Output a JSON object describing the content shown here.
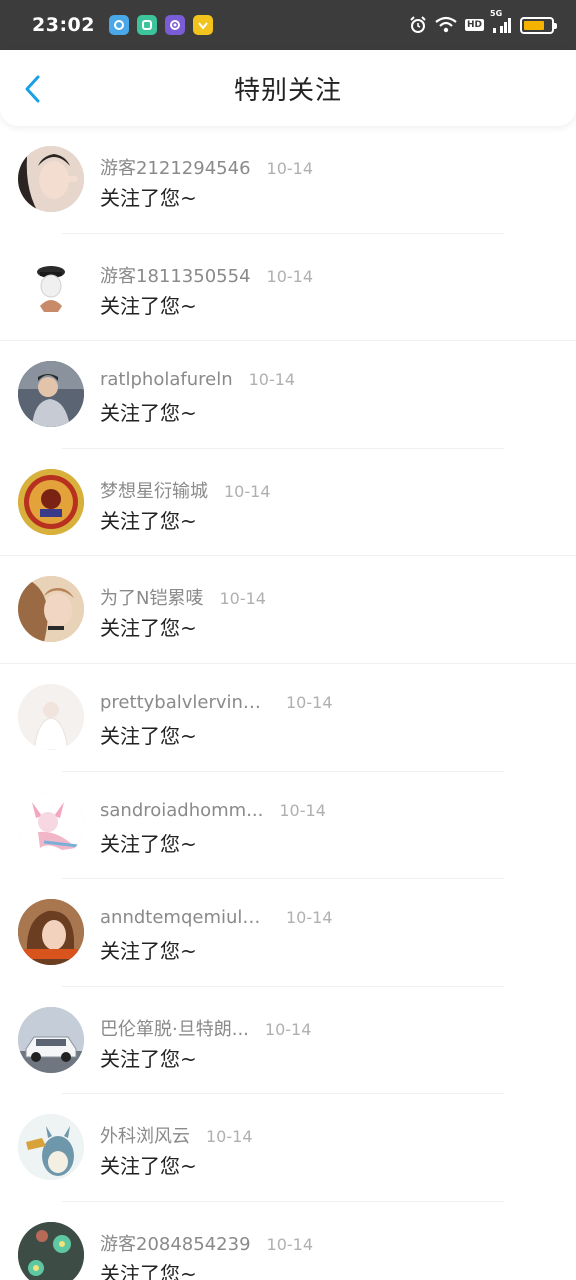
{
  "status_bar": {
    "time": "23:02",
    "app_icons": [
      {
        "name": "browser-app-icon",
        "color": "#4aa8e8"
      },
      {
        "name": "camera-app-icon",
        "color": "#3cc59a"
      },
      {
        "name": "chat-app-icon",
        "color": "#7a5cd6"
      },
      {
        "name": "wallet-app-icon",
        "color": "#f2c21d"
      }
    ],
    "hd_label": "HD",
    "network_label": "5G",
    "battery_level": 0.75
  },
  "header": {
    "title": "特别关注",
    "back_icon": "chevron-left-icon",
    "accent_color": "#1aa0e6"
  },
  "list": [
    {
      "username": "游客2121294546",
      "date": "10-14",
      "message": "关注了您~",
      "avatar_color": "#d9c8bf",
      "avatar_icon": "face-photo"
    },
    {
      "username": "游客1811350554",
      "date": "10-14",
      "message": "关注了您~",
      "avatar_color": "#ffffff",
      "avatar_icon": "bust-figure"
    },
    {
      "username": "ratlpholafureln",
      "date": "10-14",
      "message": "关注了您~",
      "avatar_color": "#4d5866",
      "avatar_icon": "person-photo"
    },
    {
      "username": "梦想星衍输城",
      "date": "10-14",
      "message": "关注了您~",
      "avatar_color": "#c9a033",
      "avatar_icon": "gold-badge"
    },
    {
      "username": "为了N铠累唛",
      "date": "10-14",
      "message": "关注了您~",
      "avatar_color": "#d8b58e",
      "avatar_icon": "girl-photo"
    },
    {
      "username": "prettybalvlervinasg",
      "date": "10-14",
      "message": "关注了您~",
      "avatar_color": "#f1ece8",
      "avatar_icon": "light-photo"
    },
    {
      "username": "sandroiadhomm...",
      "date": "10-14",
      "message": "关注了您~",
      "avatar_color": "#f6e3ea",
      "avatar_icon": "anime-figure"
    },
    {
      "username": "anndtemqemiule...",
      "date": "10-14",
      "message": "关注了您~",
      "avatar_color": "#8a5a3c",
      "avatar_icon": "woman-photo"
    },
    {
      "username": "巴伦箪脱·旦特朗...",
      "date": "10-14",
      "message": "关注了您~",
      "avatar_color": "#a9b4c0",
      "avatar_icon": "car-photo"
    },
    {
      "username": "外科浏风云",
      "date": "10-14",
      "message": "关注了您~",
      "avatar_color": "#e8eef1",
      "avatar_icon": "totoro-figure"
    },
    {
      "username": "游客2084854239",
      "date": "10-14",
      "message": "关注了您~",
      "avatar_color": "#3b4a44",
      "avatar_icon": "flower-photo"
    }
  ]
}
